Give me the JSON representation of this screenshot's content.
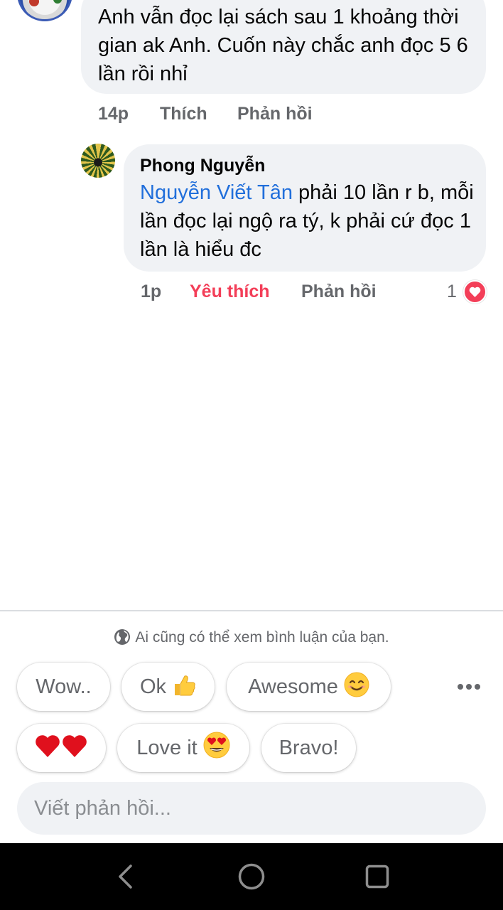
{
  "comments": [
    {
      "text": "Anh vẫn đọc lại sách sau 1 khoảng thời gian ak Anh. Cuốn này chắc anh đọc 5 6 lần rồi nhỉ",
      "time": "14p",
      "like_label": "Thích",
      "reply_label": "Phản hồi"
    },
    {
      "author": "Phong Nguyễn",
      "mention": "Nguyễn Viết Tân",
      "text": " phải 10 lần r b, mỗi lần đọc lại ngộ ra tý, k phải cứ đọc 1 lần là hiểu đc",
      "time": "1p",
      "like_label": "Yêu thích",
      "reply_label": "Phản hồi",
      "reaction_count": "1",
      "reaction_icon": "heart-icon",
      "liked_color": "#f33e58"
    }
  ],
  "composer": {
    "privacy_text": "Ai cũng có thể xem bình luận của bạn.",
    "privacy_icon": "globe-icon",
    "quick_replies": [
      {
        "label": "Wow..",
        "emoji": ""
      },
      {
        "label": "Ok",
        "emoji": "thumbs-up-emoji"
      },
      {
        "label": "Awesome",
        "emoji": "smiling-face-emoji"
      },
      {
        "label": "",
        "emoji": "two-hearts-emoji"
      },
      {
        "label": "Love it",
        "emoji": "heart-eyes-emoji"
      },
      {
        "label": "Bravo!",
        "emoji": ""
      }
    ],
    "more_icon": "more-options-icon",
    "input_placeholder": "Viết phản hồi..."
  },
  "navbar": {
    "buttons": [
      "back-icon",
      "home-icon",
      "recents-icon"
    ]
  },
  "colors": {
    "bubble": "#f0f2f5",
    "meta_text": "#65676b",
    "mention": "#216fdb",
    "love_red": "#f33e58",
    "navbar": "#000000"
  }
}
